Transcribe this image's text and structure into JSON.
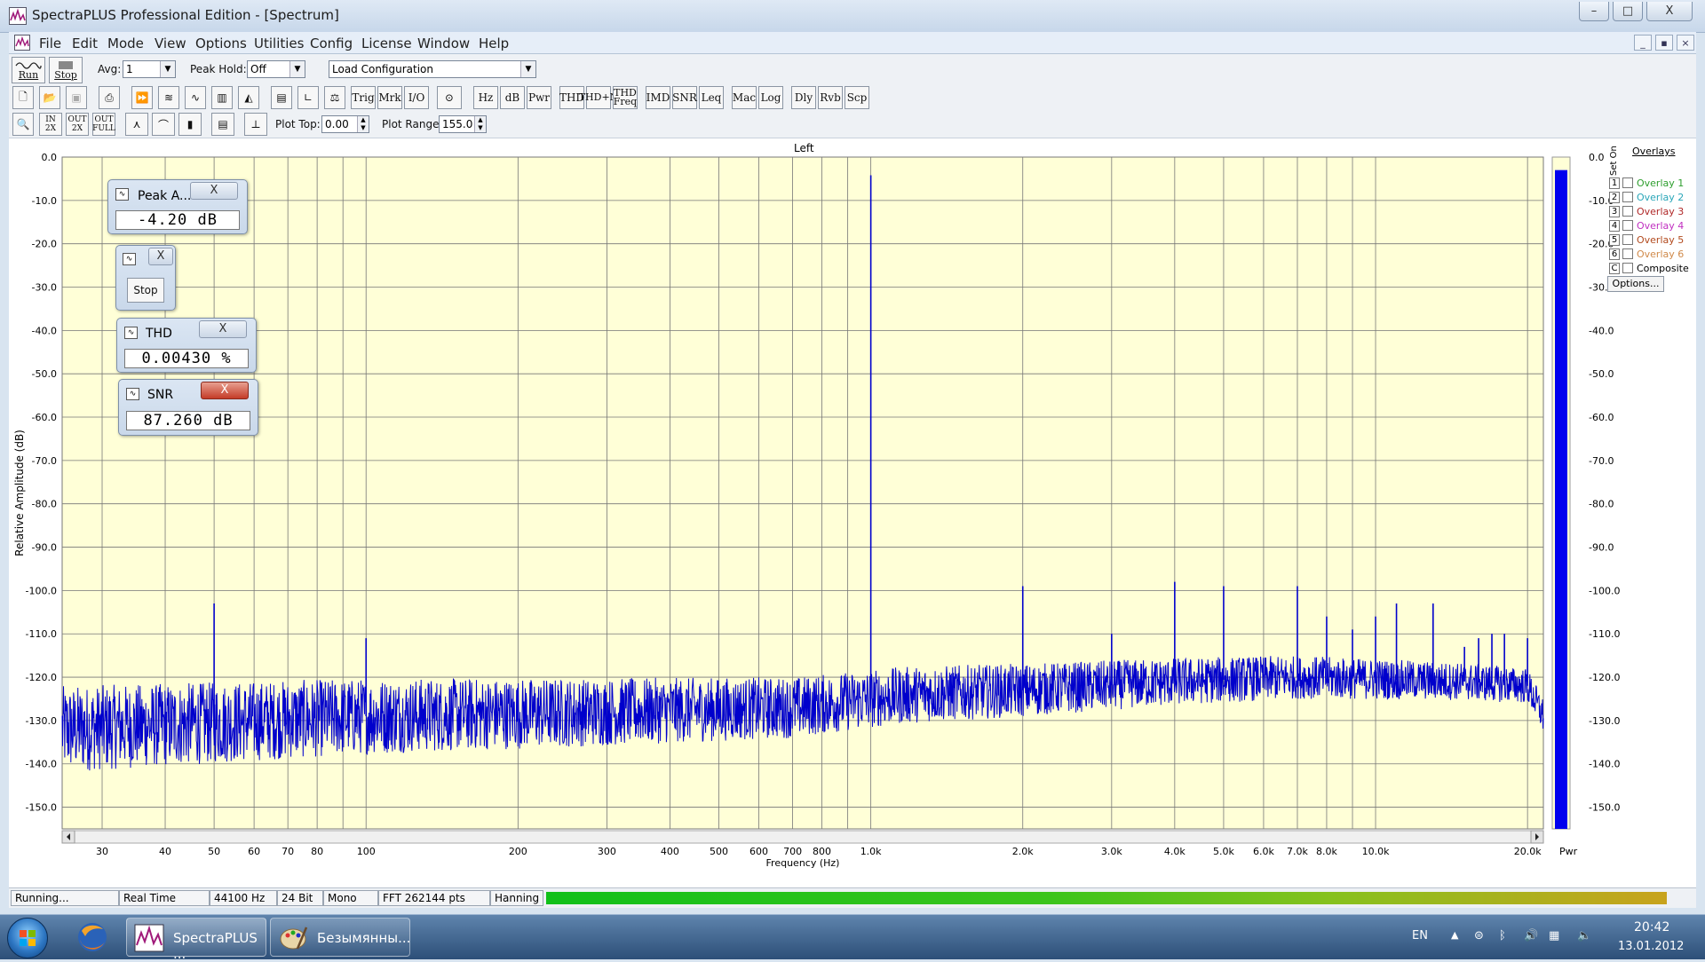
{
  "window": {
    "title": "SpectraPLUS Professional Edition - [Spectrum]",
    "min": "–",
    "max": "□",
    "close": "X"
  },
  "menu": [
    "File",
    "Edit",
    "Mode",
    "View",
    "Options",
    "Utilities",
    "Config",
    "License",
    "Window",
    "Help"
  ],
  "mdi_controls": [
    "_",
    "▪",
    "×"
  ],
  "toolbar1": {
    "run": "Run",
    "stop": "Stop",
    "avg_label": "Avg:",
    "avg_value": "1",
    "peak_hold_label": "Peak Hold:",
    "peak_hold_value": "Off",
    "config_value": "Load Configuration"
  },
  "toolbar2": [
    "Trig",
    "Mrk",
    "I/O",
    "Hz",
    "dB",
    "Pwr",
    "THD",
    "THD+N",
    "THD Freq",
    "IMD",
    "SNR",
    "Leq",
    "Mac",
    "Log",
    "Dly",
    "Rvb",
    "Scp"
  ],
  "toolbar3": {
    "zoom_buttons": [
      "IN 2X",
      "OUT 2X",
      "OUT FULL"
    ],
    "plot_top_label": "Plot Top:",
    "plot_top_value": "0.00",
    "plot_range_label": "Plot Range:",
    "plot_range_value": "155.0"
  },
  "plot": {
    "channel": "Left",
    "ylabel": "Relative Amplitude (dB)",
    "xlabel": "Frequency (Hz)",
    "pwr_label": "Pwr",
    "line_color": "#0000cc",
    "bg_color": "#ffffd7"
  },
  "chart_data": {
    "type": "line",
    "x_scale": "log",
    "xlim": [
      25,
      21500
    ],
    "ylim": [
      -155,
      0
    ],
    "y_ticks": [
      "0.0",
      "-10.0",
      "-20.0",
      "-30.0",
      "-40.0",
      "-50.0",
      "-60.0",
      "-70.0",
      "-80.0",
      "-90.0",
      "-100.0",
      "-110.0",
      "-120.0",
      "-130.0",
      "-140.0",
      "-150.0"
    ],
    "x_ticks": [
      {
        "f": 30,
        "label": "30"
      },
      {
        "f": 40,
        "label": "40"
      },
      {
        "f": 50,
        "label": "50"
      },
      {
        "f": 60,
        "label": "60"
      },
      {
        "f": 70,
        "label": "70"
      },
      {
        "f": 80,
        "label": "80"
      },
      {
        "f": 100,
        "label": "100"
      },
      {
        "f": 200,
        "label": "200"
      },
      {
        "f": 300,
        "label": "300"
      },
      {
        "f": 400,
        "label": "400"
      },
      {
        "f": 500,
        "label": "500"
      },
      {
        "f": 600,
        "label": "600"
      },
      {
        "f": 700,
        "label": "700"
      },
      {
        "f": 800,
        "label": "800"
      },
      {
        "f": 1000,
        "label": "1.0k"
      },
      {
        "f": 2000,
        "label": "2.0k"
      },
      {
        "f": 3000,
        "label": "3.0k"
      },
      {
        "f": 4000,
        "label": "4.0k"
      },
      {
        "f": 5000,
        "label": "5.0k"
      },
      {
        "f": 6000,
        "label": "6.0k"
      },
      {
        "f": 7000,
        "label": "7.0k"
      },
      {
        "f": 8000,
        "label": "8.0k"
      },
      {
        "f": 10000,
        "label": "10.0k"
      },
      {
        "f": 20000,
        "label": "20.0k"
      }
    ],
    "noise_floor": [
      [
        25,
        -132
      ],
      [
        100,
        -129
      ],
      [
        300,
        -128
      ],
      [
        700,
        -127
      ],
      [
        1200,
        -124
      ],
      [
        2000,
        -123
      ],
      [
        4000,
        -121
      ],
      [
        7000,
        -120
      ],
      [
        15000,
        -121
      ],
      [
        20000,
        -122
      ],
      [
        21500,
        -129
      ]
    ],
    "peaks": [
      {
        "f": 50,
        "db": -103
      },
      {
        "f": 100,
        "db": -111
      },
      {
        "f": 1000,
        "db": -4.2
      },
      {
        "f": 2000,
        "db": -99
      },
      {
        "f": 3000,
        "db": -110
      },
      {
        "f": 4000,
        "db": -98
      },
      {
        "f": 5000,
        "db": -99
      },
      {
        "f": 7000,
        "db": -99
      },
      {
        "f": 8000,
        "db": -106
      },
      {
        "f": 9000,
        "db": -109
      },
      {
        "f": 10000,
        "db": -106
      },
      {
        "f": 11000,
        "db": -103
      },
      {
        "f": 13000,
        "db": -103
      },
      {
        "f": 15000,
        "db": -113
      },
      {
        "f": 16000,
        "db": -111
      },
      {
        "f": 17000,
        "db": -110
      },
      {
        "f": 18000,
        "db": -110
      },
      {
        "f": 20000,
        "db": -111
      }
    ],
    "grid": true
  },
  "meter_bar_level_db": -3,
  "meters": [
    {
      "title": "Peak A...",
      "value": "-4.20 dB"
    },
    {
      "button": "Stop"
    },
    {
      "title": "THD",
      "value": "0.00430 %"
    },
    {
      "title": "SNR",
      "value": "87.260 dB"
    }
  ],
  "overlays": {
    "title": "Overlays",
    "set_on": "Set On",
    "items": [
      {
        "num": "1",
        "name": "Overlay 1",
        "color": "#2e9e2e"
      },
      {
        "num": "2",
        "name": "Overlay 2",
        "color": "#2aa6b8"
      },
      {
        "num": "3",
        "name": "Overlay 3",
        "color": "#b02828"
      },
      {
        "num": "4",
        "name": "Overlay 4",
        "color": "#c030c0"
      },
      {
        "num": "5",
        "name": "Overlay 5",
        "color": "#b24a1e"
      },
      {
        "num": "6",
        "name": "Overlay 6",
        "color": "#d08a4a"
      },
      {
        "num": "C",
        "name": "Composite",
        "color": "#000000"
      }
    ],
    "options": "Options..."
  },
  "status": [
    "Running...",
    "Real Time",
    "44100 Hz",
    "24 Bit",
    "Mono",
    "FFT 262144 pts",
    "Hanning"
  ],
  "taskbar": {
    "tasks": [
      "SpectraPLUS ...",
      "Безымянны..."
    ],
    "lang": "EN",
    "time": "20:42",
    "date": "13.01.2012"
  }
}
